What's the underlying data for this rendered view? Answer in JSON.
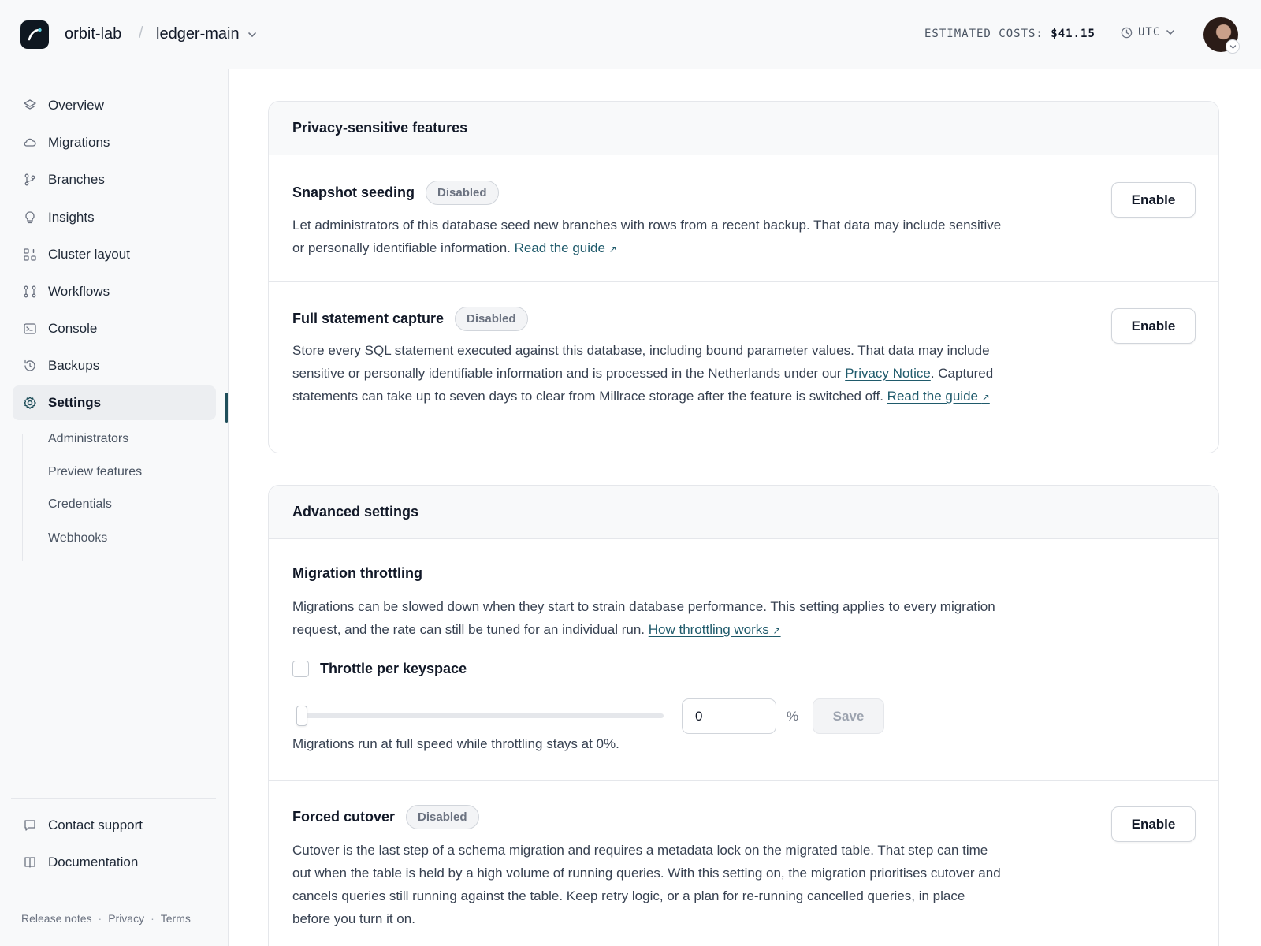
{
  "header": {
    "org": "orbit-lab",
    "separator": "/",
    "database": "ledger-main",
    "costs_label": "ESTIMATED COSTS:",
    "costs_value": "$41.15",
    "timezone": "UTC"
  },
  "sidebar": {
    "items": [
      {
        "label": "Overview",
        "icon": "layers-icon"
      },
      {
        "label": "Migrations",
        "icon": "cloud-icon"
      },
      {
        "label": "Branches",
        "icon": "git-branch-icon"
      },
      {
        "label": "Insights",
        "icon": "lightbulb-icon"
      },
      {
        "label": "Cluster layout",
        "icon": "grid-plus-icon"
      },
      {
        "label": "Workflows",
        "icon": "workflow-icon"
      },
      {
        "label": "Console",
        "icon": "terminal-icon"
      },
      {
        "label": "Backups",
        "icon": "history-icon"
      },
      {
        "label": "Settings",
        "icon": "gear-icon",
        "active": true
      }
    ],
    "subitems": [
      "Administrators",
      "Preview features",
      "Credentials",
      "Webhooks"
    ],
    "bottom": [
      {
        "label": "Contact support",
        "icon": "chat-icon"
      },
      {
        "label": "Documentation",
        "icon": "book-icon"
      }
    ],
    "footer": {
      "release_notes": "Release notes",
      "privacy": "Privacy",
      "terms": "Terms",
      "dot": "·"
    }
  },
  "privacy_section": {
    "title": "Privacy-sensitive features",
    "snapshot": {
      "title": "Snapshot seeding",
      "badge": "Disabled",
      "desc": "Let administrators of this database seed new branches with rows from a recent backup. That data may include sensitive or personally identifiable information. ",
      "link": "Read the guide",
      "button": "Enable"
    },
    "statement": {
      "title": "Full statement capture",
      "badge": "Disabled",
      "desc_a": "Store every SQL statement executed against this database, including bound parameter values. That data may include sensitive or personally identifiable information and is processed in the Netherlands under our ",
      "link_privacy": "Privacy Notice",
      "desc_b": ". Captured statements can take up to seven days to clear from Millrace storage after the feature is switched off. ",
      "link": "Read the guide",
      "button": "Enable"
    }
  },
  "advanced_section": {
    "title": "Advanced settings",
    "throttling": {
      "title": "Migration throttling",
      "desc": "Migrations can be slowed down when they start to strain database performance. This setting applies to every migration request, and the rate can still be tuned for an individual run. ",
      "link": "How throttling works",
      "checkbox_label": "Throttle per keyspace",
      "checked": false,
      "slider_value": 0,
      "input_value": "0",
      "unit": "%",
      "save": "Save",
      "hint": "Migrations run at full speed while throttling stays at 0%."
    },
    "cutover": {
      "title": "Forced cutover",
      "badge": "Disabled",
      "desc": "Cutover is the last step of a schema migration and requires a metadata lock on the migrated table. That step can time out when the table is held by a high volume of running queries. With this setting on, the migration prioritises cutover and cancels queries still running against the table. Keep retry logic, or a plan for re-running cancelled queries, in place before you turn it on.",
      "button": "Enable"
    }
  },
  "colors": {
    "accent": "#1f5a6b",
    "active_bar": "#1f4e5a",
    "sidebar_bg": "#f8f9fa"
  }
}
